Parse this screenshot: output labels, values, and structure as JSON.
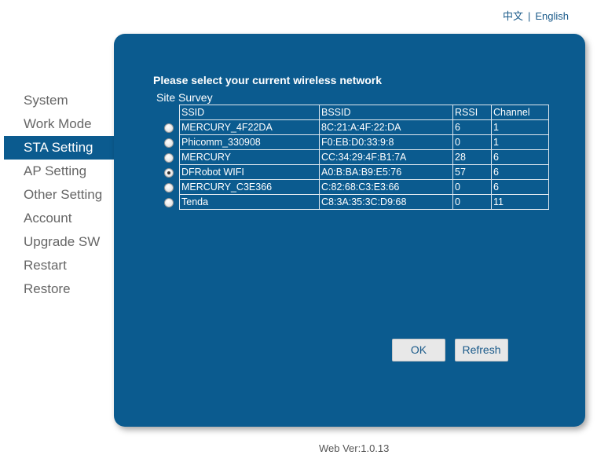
{
  "lang": {
    "chinese": "中文",
    "separator": "|",
    "english": "English"
  },
  "sidebar": {
    "items": [
      {
        "label": "System"
      },
      {
        "label": "Work Mode"
      },
      {
        "label": "STA Setting",
        "active": true
      },
      {
        "label": "AP Setting"
      },
      {
        "label": "Other Setting"
      },
      {
        "label": "Account"
      },
      {
        "label": "Upgrade SW"
      },
      {
        "label": "Restart"
      },
      {
        "label": "Restore"
      }
    ]
  },
  "panel": {
    "title": "Please select your current wireless network",
    "survey_label": "Site Survey",
    "headers": {
      "ssid": "SSID",
      "bssid": "BSSID",
      "rssi": "RSSI",
      "channel": "Channel"
    },
    "networks": [
      {
        "ssid": "MERCURY_4F22DA",
        "bssid": "8C:21:A:4F:22:DA",
        "rssi": "6",
        "channel": "1",
        "selected": false
      },
      {
        "ssid": "Phicomm_330908",
        "bssid": "F0:EB:D0:33:9:8",
        "rssi": "0",
        "channel": "1",
        "selected": false
      },
      {
        "ssid": "MERCURY",
        "bssid": "CC:34:29:4F:B1:7A",
        "rssi": "28",
        "channel": "6",
        "selected": false
      },
      {
        "ssid": "DFRobot WIFI",
        "bssid": "A0:B:BA:B9:E5:76",
        "rssi": "57",
        "channel": "6",
        "selected": true
      },
      {
        "ssid": "MERCURY_C3E366",
        "bssid": "C:82:68:C3:E3:66",
        "rssi": "0",
        "channel": "6",
        "selected": false
      },
      {
        "ssid": "Tenda",
        "bssid": "C8:3A:35:3C:D9:68",
        "rssi": "0",
        "channel": "11",
        "selected": false
      }
    ],
    "ok_label": "OK",
    "refresh_label": "Refresh"
  },
  "footer": {
    "version": "Web Ver:1.0.13"
  },
  "colors": {
    "panel_bg": "#0b5b8f",
    "link": "#1a5a8a"
  }
}
